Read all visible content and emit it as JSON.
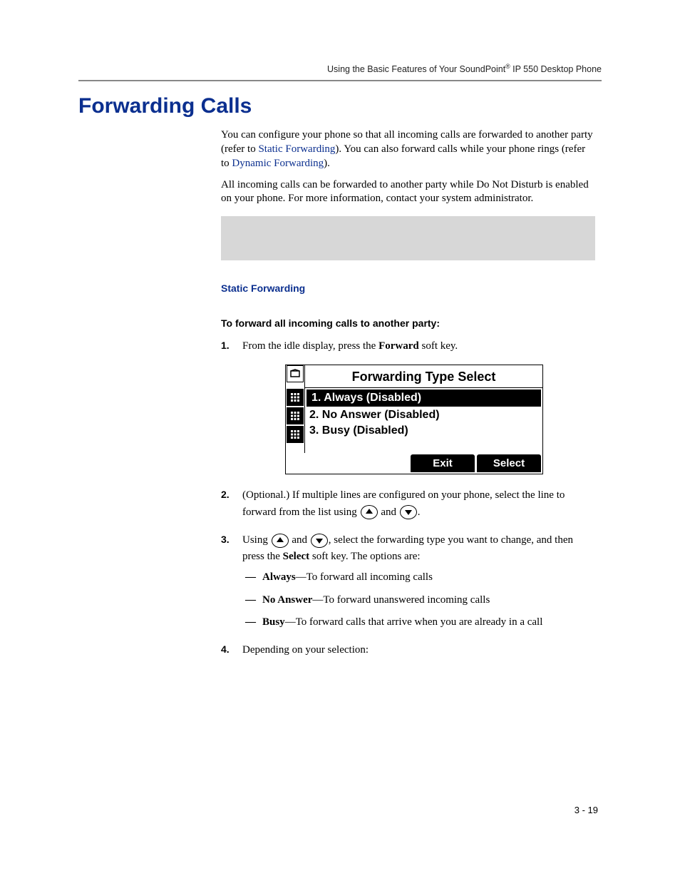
{
  "header": {
    "running_head_pre": "Using the Basic Features of Your SoundPoint",
    "running_head_reg": "®",
    "running_head_post": " IP 550 Desktop Phone"
  },
  "title": "Forwarding Calls",
  "intro": {
    "p1_a": "You can configure your phone so that all incoming calls are forwarded to another party (refer to ",
    "link1": "Static Forwarding",
    "p1_b": "). You can also forward calls while your phone rings (refer to ",
    "link2": "Dynamic Forwarding",
    "p1_c": ").",
    "p2": "All incoming calls can be forwarded to another party while Do Not Disturb is enabled on your phone. For more information, contact your system administrator."
  },
  "section": {
    "heading": "Static Forwarding",
    "proc_heading": "To forward all incoming calls to another party:"
  },
  "steps": {
    "s1_a": "From the idle display, press the ",
    "s1_bold": "Forward",
    "s1_b": " soft key.",
    "s2_a": "(Optional.) If multiple lines are configured on your phone, select the line to forward from the list using ",
    "s2_and1": " and ",
    "s2_end": ".",
    "s3_a": "Using ",
    "s3_and": " and ",
    "s3_b": ", select the forwarding type you want to change, and then press the ",
    "s3_bold": "Select",
    "s3_c": " soft key. The options are:",
    "s4": "Depending on your selection:"
  },
  "options": {
    "o1_b": "Always",
    "o1_t": "—To forward all incoming calls",
    "o2_b": "No Answer",
    "o2_t": "—To forward unanswered incoming calls",
    "o3_b": "Busy",
    "o3_t": "—To forward calls that arrive when you are already in a call"
  },
  "screen": {
    "title": "Forwarding Type Select",
    "items": [
      "1. Always (Disabled)",
      "2. No Answer (Disabled)",
      "3. Busy (Disabled)"
    ],
    "soft_exit": "Exit",
    "soft_select": "Select"
  },
  "page_num": "3 - 19"
}
